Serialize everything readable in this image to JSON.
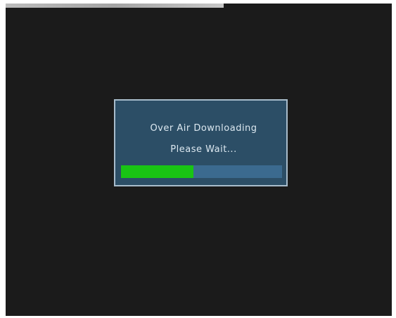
{
  "dialog": {
    "message": "Over Air Downloading",
    "submessage": "Please Wait..."
  },
  "progress": {
    "value": 0.45
  },
  "colors": {
    "screen_background": "#1b1b1b",
    "dialog_background": "#2c4e66",
    "dialog_border": "#a8bccb",
    "progress_track": "#3b6a8f",
    "progress_fill": "#19c414",
    "text": "#dce8f0"
  }
}
